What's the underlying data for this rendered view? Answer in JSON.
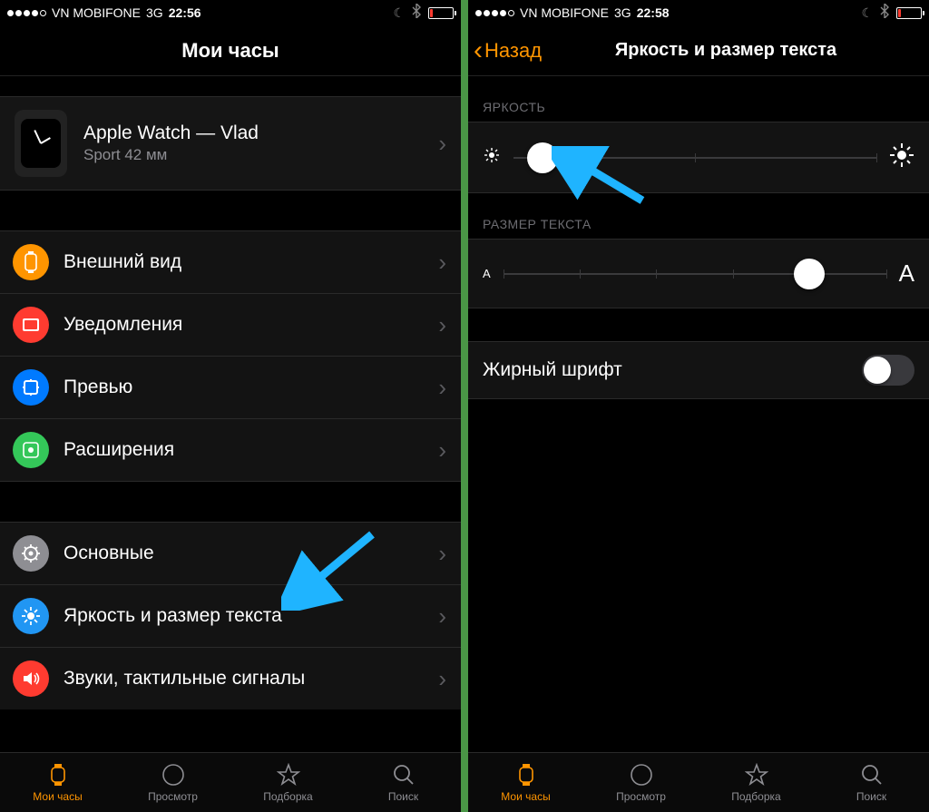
{
  "left": {
    "status": {
      "carrier": "VN MOBIFONE",
      "network": "3G",
      "time": "22:56"
    },
    "nav_title": "Мои часы",
    "device": {
      "title": "Apple Watch — Vlad",
      "subtitle": "Sport 42 мм"
    },
    "rows1": [
      {
        "label": "Внешний вид"
      },
      {
        "label": "Уведомления"
      },
      {
        "label": "Превью"
      },
      {
        "label": "Расширения"
      }
    ],
    "rows2": [
      {
        "label": "Основные"
      },
      {
        "label": "Яркость и размер текста"
      },
      {
        "label": "Звуки, тактильные сигналы"
      }
    ],
    "tabs": [
      {
        "label": "Мои часы"
      },
      {
        "label": "Просмотр"
      },
      {
        "label": "Подборка"
      },
      {
        "label": "Поиск"
      }
    ]
  },
  "right": {
    "status": {
      "carrier": "VN MOBIFONE",
      "network": "3G",
      "time": "22:58"
    },
    "nav_back": "Назад",
    "nav_title": "Яркость и размер текста",
    "section_brightness": "ЯРКОСТЬ",
    "section_textsize": "РАЗМЕР ТЕКСТА",
    "textsize_small": "A",
    "textsize_large": "A",
    "bold_label": "Жирный шрифт",
    "tabs": [
      {
        "label": "Мои часы"
      },
      {
        "label": "Просмотр"
      },
      {
        "label": "Подборка"
      },
      {
        "label": "Поиск"
      }
    ]
  }
}
